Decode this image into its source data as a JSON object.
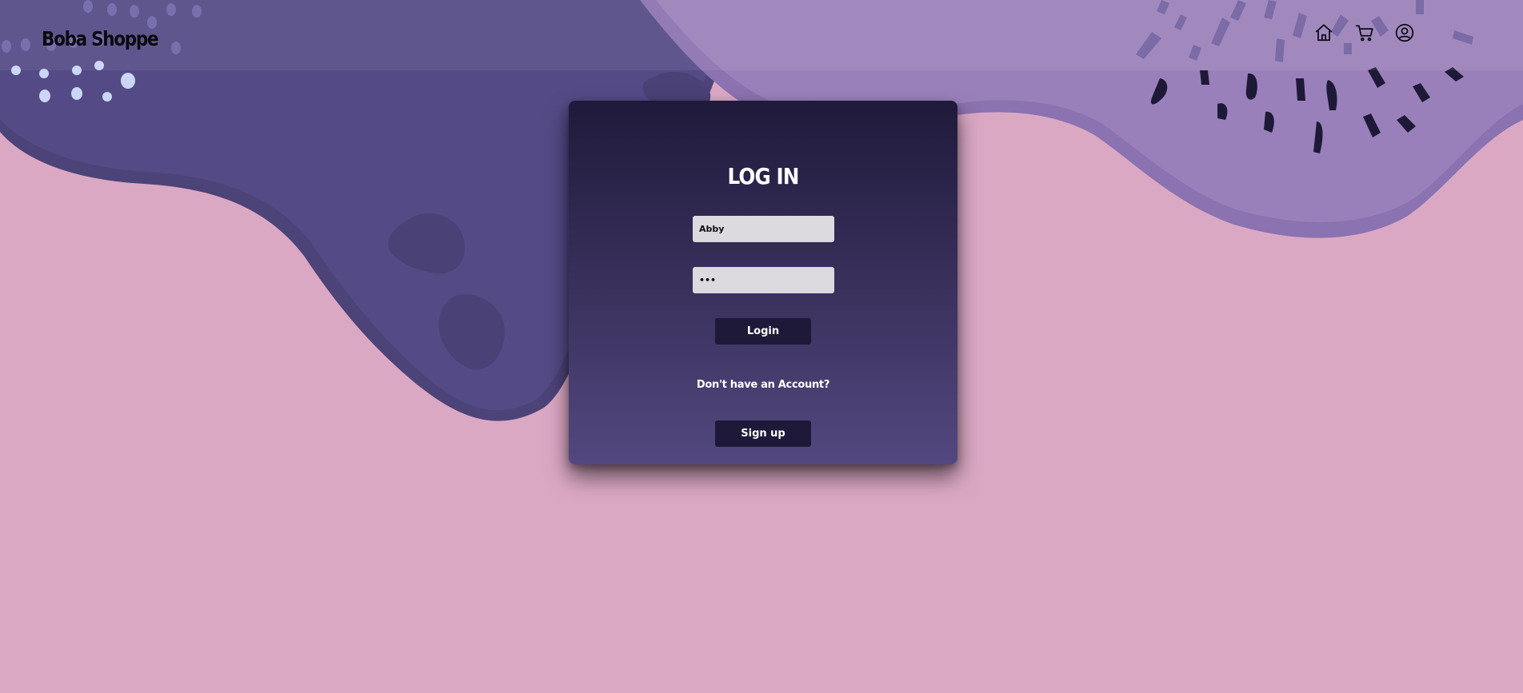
{
  "brand": {
    "name": "Boba Shoppe"
  },
  "nav": {
    "icons": [
      "home-icon",
      "cart-icon",
      "account-icon"
    ]
  },
  "login": {
    "title": "LOG IN",
    "username_value": "Abby",
    "password_value": "aaa",
    "login_label": "Login",
    "no_account_text": "Don't have an Account?",
    "signup_label": "Sign up"
  },
  "colors": {
    "background": "#dba8c4",
    "wave_dark": "#534a86",
    "wave_light": "#9a80ba",
    "card_top": "#1f1a3b",
    "card_bottom": "#52487f",
    "button": "#1f1939",
    "input": "#dcdadf"
  }
}
